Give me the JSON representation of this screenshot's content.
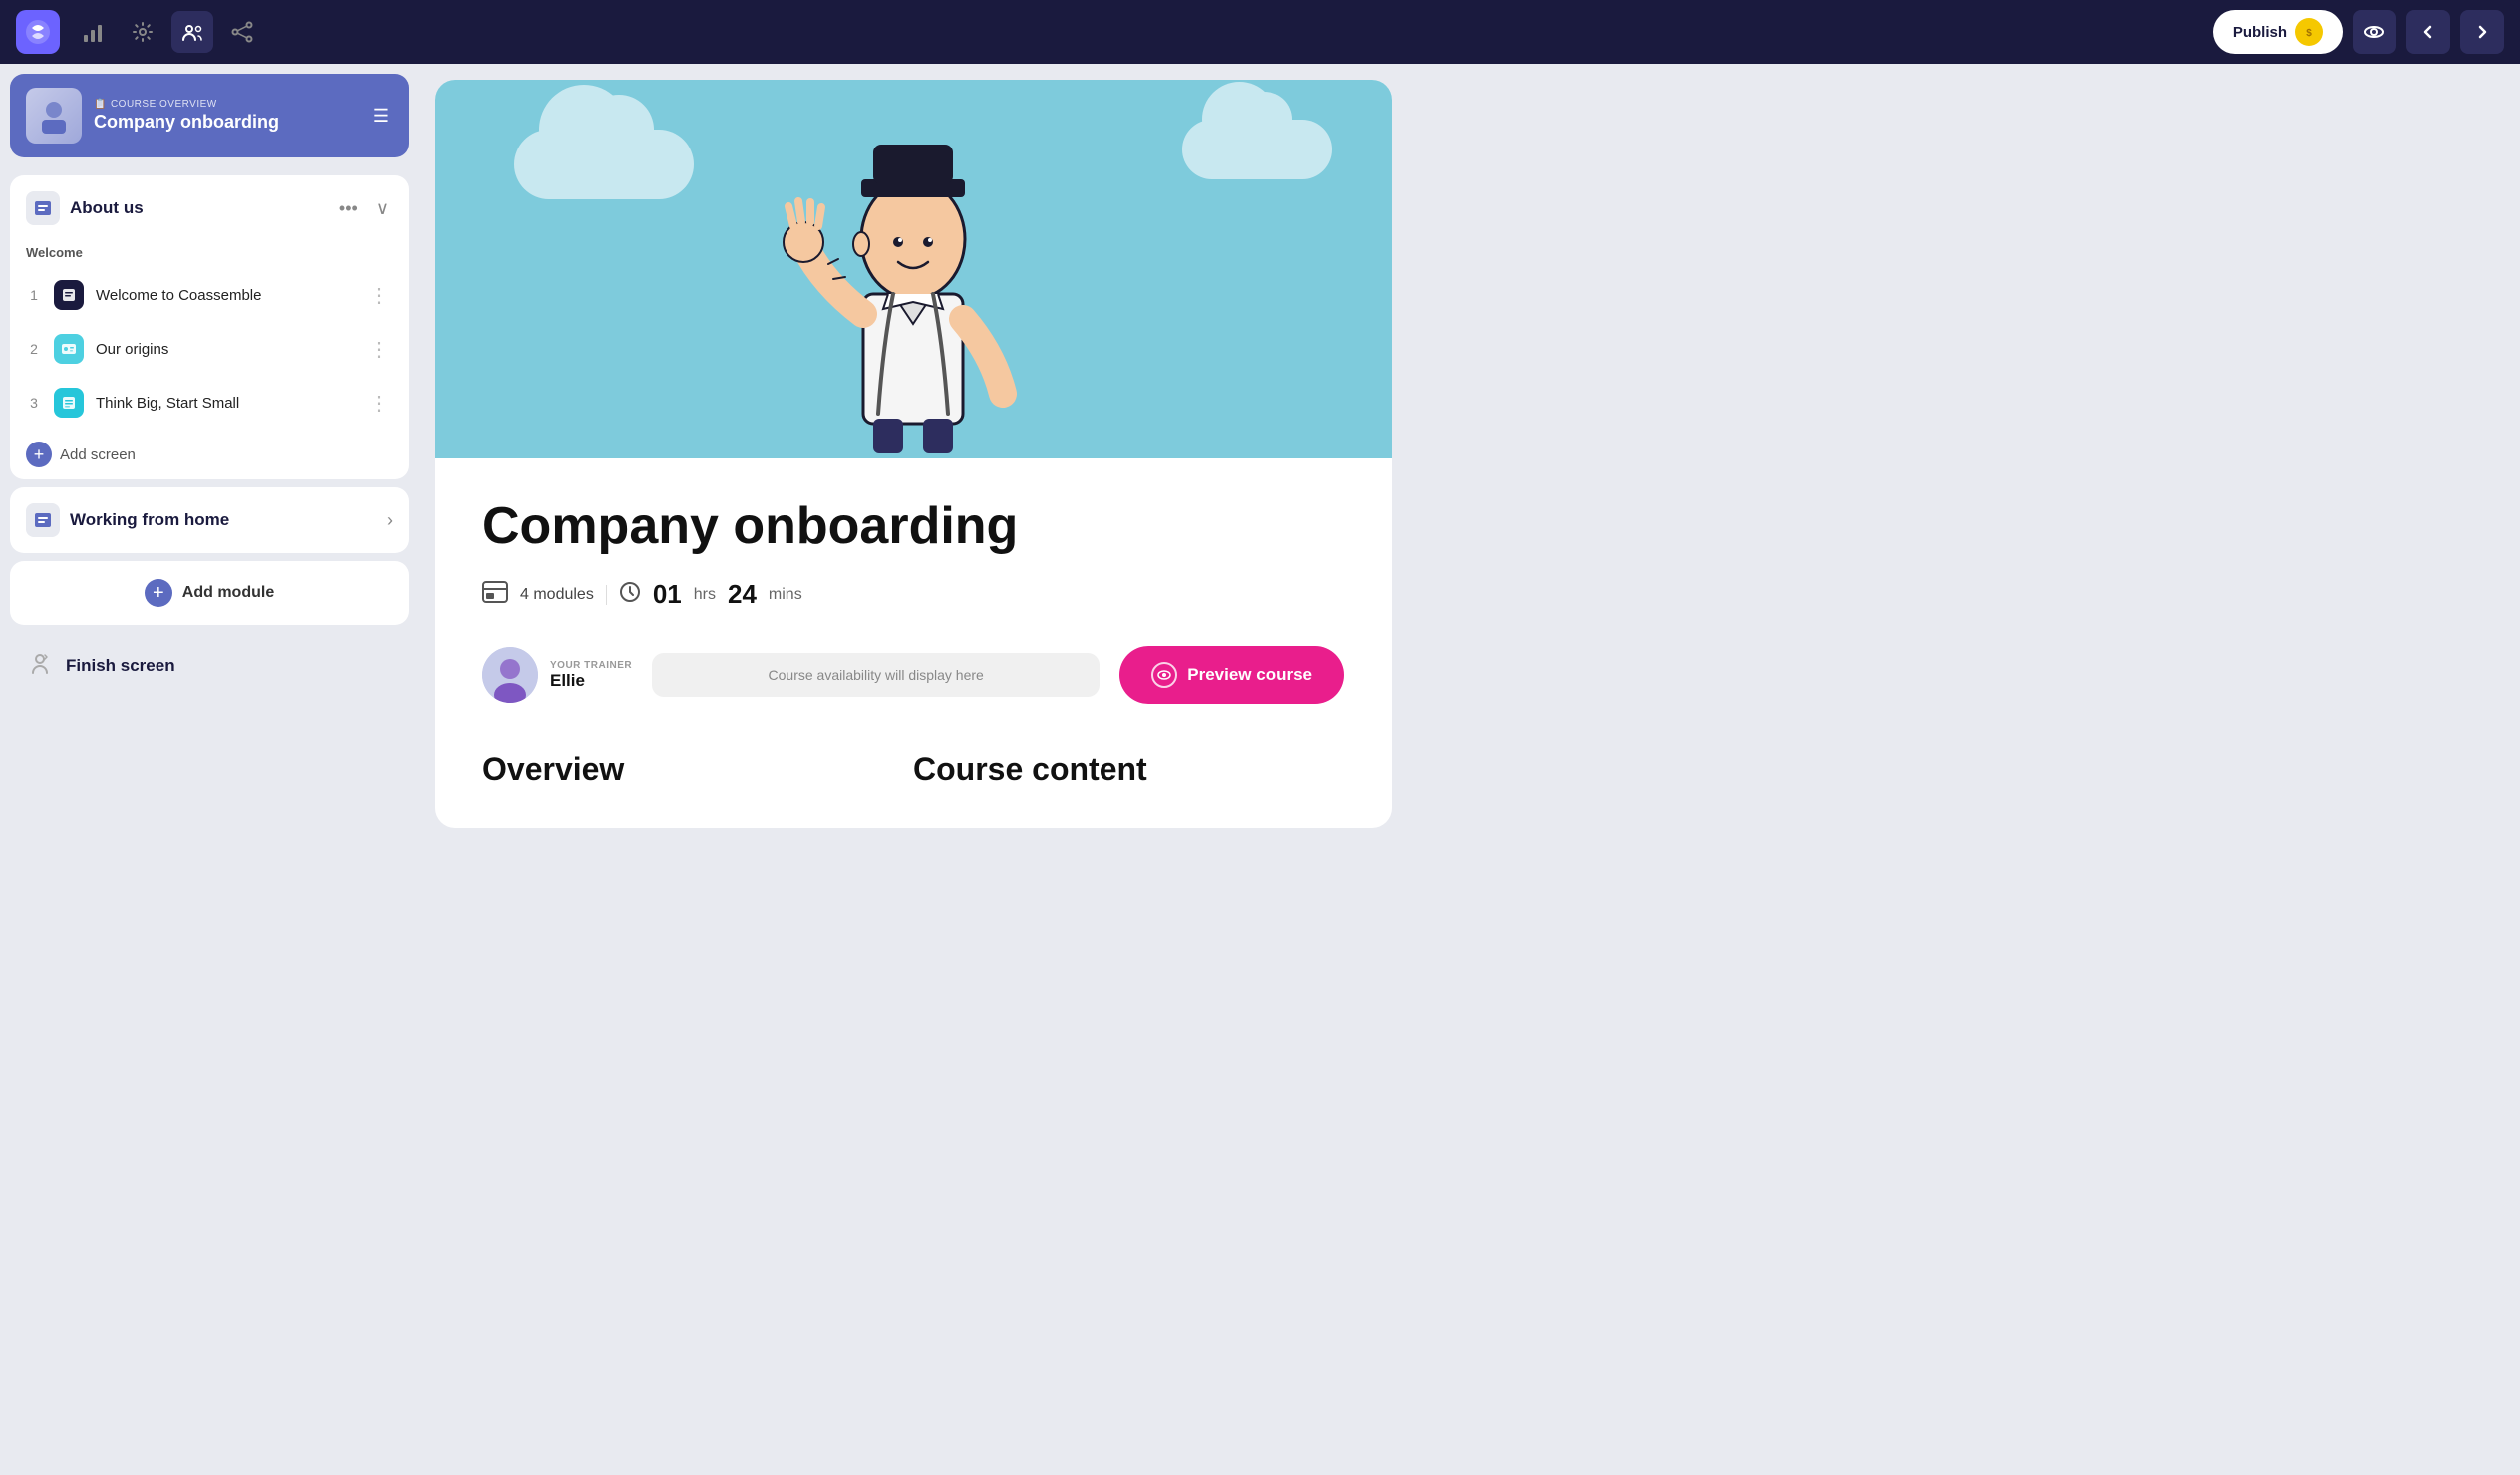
{
  "app": {
    "logo": "G"
  },
  "topbar": {
    "icons": [
      {
        "name": "analytics-icon",
        "label": "Analytics"
      },
      {
        "name": "settings-icon",
        "label": "Settings"
      },
      {
        "name": "team-icon",
        "label": "Team",
        "active": true
      },
      {
        "name": "share-icon",
        "label": "Share"
      }
    ],
    "publish_label": "Publish",
    "nav_back": "←",
    "nav_forward": "→"
  },
  "sidebar": {
    "course_overview_label": "COURSE OVERVIEW",
    "course_title": "Company onboarding",
    "modules": [
      {
        "id": "about-us",
        "title": "About us",
        "expanded": true,
        "sections": [
          {
            "label": "Welcome",
            "lessons": [
              {
                "num": "1",
                "name": "Welcome to Coassemble",
                "icon_type": "dark"
              },
              {
                "num": "2",
                "name": "Our origins",
                "icon_type": "blue"
              },
              {
                "num": "3",
                "name": "Think Big, Start Small",
                "icon_type": "teal"
              }
            ]
          }
        ],
        "add_screen_label": "Add screen"
      },
      {
        "id": "working-from-home",
        "title": "Working from home",
        "expanded": false
      }
    ],
    "add_module_label": "Add module",
    "finish_screen_label": "Finish screen"
  },
  "preview": {
    "course_title": "Company onboarding",
    "modules_count": "4 modules",
    "hours": "01",
    "mins": "24",
    "hours_label": "hrs",
    "mins_label": "mins",
    "trainer_label": "YOUR TRAINER",
    "trainer_name": "Ellie",
    "availability_placeholder": "Course availability will display here",
    "preview_label": "Preview course",
    "overview_heading": "Overview",
    "content_heading": "Course content"
  }
}
